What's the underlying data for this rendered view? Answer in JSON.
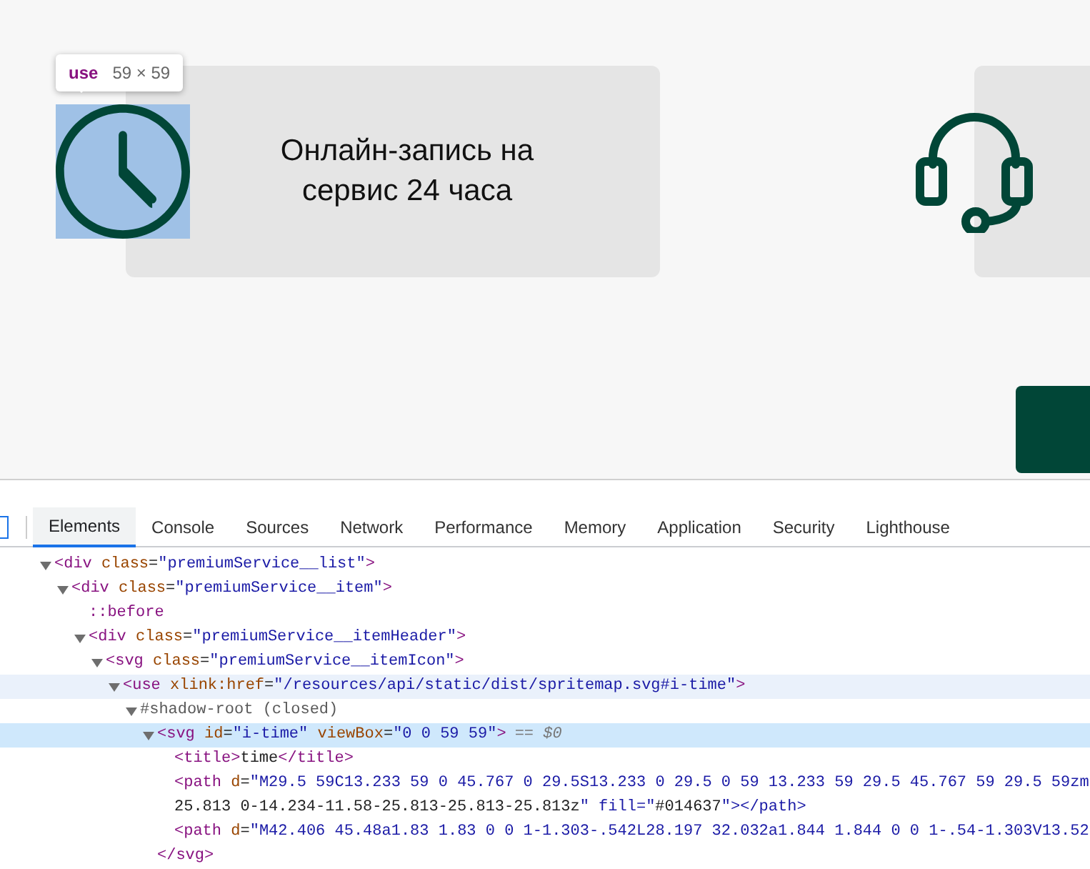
{
  "page": {
    "cards": [
      {
        "kind": "titled",
        "title": "Онлайн-запись на сервис 24 часа",
        "inspected": true
      },
      {
        "kind": "untitled",
        "inspected": false
      }
    ],
    "inspector_tooltip": {
      "tag": "use",
      "size": "59 × 59"
    }
  },
  "devtools": {
    "tabs": [
      {
        "label": "Elements",
        "selected": true
      },
      {
        "label": "Console",
        "selected": false
      },
      {
        "label": "Sources",
        "selected": false
      },
      {
        "label": "Network",
        "selected": false
      },
      {
        "label": "Performance",
        "selected": false
      },
      {
        "label": "Memory",
        "selected": false
      },
      {
        "label": "Application",
        "selected": false
      },
      {
        "label": "Security",
        "selected": false
      },
      {
        "label": "Lighthouse",
        "selected": false
      }
    ],
    "tree": [
      {
        "kind": "element",
        "lines": [
          "<div class=\"premiumService__list\">"
        ],
        "expanded": true,
        "children": [
          {
            "kind": "element",
            "lines": [
              "<div class=\"premiumService__item\">"
            ],
            "expanded": true,
            "children": [
              {
                "kind": "pseudo",
                "lines": [
                  "::before"
                ]
              },
              {
                "kind": "element",
                "lines": [
                  "<div class=\"premiumService__itemHeader\">"
                ],
                "expanded": true,
                "children": [
                  {
                    "kind": "element",
                    "lines": [
                      "<svg class=\"premiumService__itemIcon\">"
                    ],
                    "expanded": true,
                    "children": [
                      {
                        "kind": "element",
                        "lines": [
                          "<use xlink:href=\"/resources/api/static/dist/spritemap.svg#i-time\">"
                        ],
                        "expanded": true,
                        "hovered": true,
                        "children": [
                          {
                            "kind": "shadow",
                            "lines": [
                              "#shadow-root (closed)"
                            ],
                            "expanded": true,
                            "children": [
                              {
                                "kind": "element",
                                "lines": [
                                  "<svg id=\"i-time\" viewBox=\"0 0 59 59\">"
                                ],
                                "suffix": "== $0",
                                "expanded": true,
                                "selected": true,
                                "closing": "</svg>",
                                "children": [
                                  {
                                    "kind": "element",
                                    "lines": [
                                      "<title>time</title>"
                                    ]
                                  },
                                  {
                                    "kind": "element",
                                    "lines": [
                                      "<path d=\"M29.5 59C13.233 59 0 45.767 0 29.5S13.233 0 29.5 0 59 13.233 59 29.5 45.767 59 29.5 59zm",
                                      "25.813 0-14.234-11.58-25.813-25.813-25.813z\" fill=\"#014637\"></path>"
                                    ]
                                  },
                                  {
                                    "kind": "element",
                                    "lines": [
                                      "<path d=\"M42.406 45.48a1.83 1.83 0 0 1-1.303-.542L28.197 32.032a1.844 1.844 0 0 1-.54-1.303V13.52"
                                    ]
                                  }
                                ]
                              }
                            ]
                          }
                        ]
                      }
                    ]
                  }
                ]
              }
            ]
          }
        ]
      }
    ]
  }
}
